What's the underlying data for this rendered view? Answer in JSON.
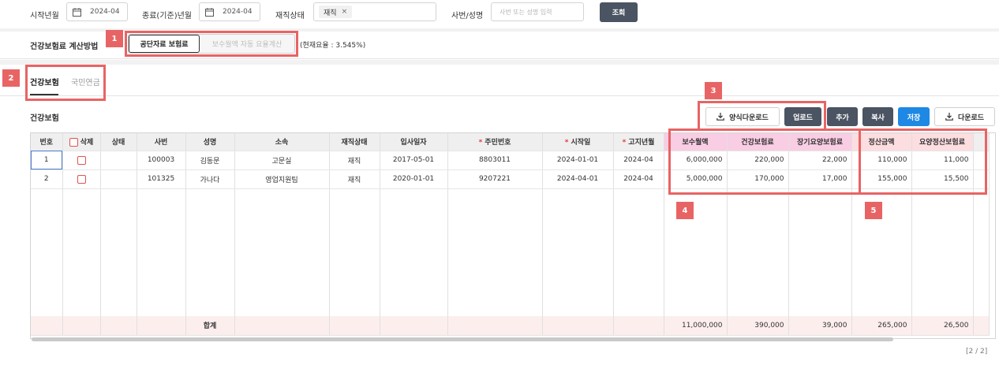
{
  "filters": {
    "start_label": "시작년월",
    "start_value": "2024-04",
    "end_label": "종료(기준)년월",
    "end_value": "2024-04",
    "status_label": "재직상태",
    "status_chip": "재직",
    "status_chip_remove": "×",
    "search_label": "사번/성명",
    "search_placeholder": "사번 또는 성명 입력",
    "search_button": "조회"
  },
  "calc": {
    "label": "건강보험료 계산방법",
    "option_active": "공단자료 보험료",
    "option_inactive": "보수월액 자동 요율계산",
    "rate_text": "(현재요율 : 3.545%)"
  },
  "tabs": {
    "active": "건강보험",
    "inactive": "국민연금"
  },
  "section": {
    "title": "건강보험",
    "btn_template_download": "양식다운로드",
    "btn_upload": "업로드",
    "btn_add": "추가",
    "btn_copy": "복사",
    "btn_save": "저장",
    "btn_download": "다운로드"
  },
  "table": {
    "headers": {
      "no": "번호",
      "delete": "삭제",
      "state": "상태",
      "emp_no": "사번",
      "name": "성명",
      "dept": "소속",
      "status": "재직상태",
      "join_date": "입사일자",
      "rrn": "주민번호",
      "start": "시작일",
      "notice": "고지년월",
      "monthly_pay": "보수월액",
      "health": "건강보험료",
      "ltc": "장기요양보험료",
      "settle": "정산금액",
      "ltc_settle": "요양정산보험료"
    },
    "rows": [
      {
        "no": "1",
        "emp_no": "100003",
        "name": "김동문",
        "dept": "고문실",
        "status": "재직",
        "join_date": "2017-05-01",
        "rrn": "8803011",
        "start": "2024-01-01",
        "notice": "2024-04",
        "monthly_pay": "6,000,000",
        "health": "220,000",
        "ltc": "22,000",
        "settle": "110,000",
        "ltc_settle": "11,000"
      },
      {
        "no": "2",
        "emp_no": "101325",
        "name": "가나다",
        "dept": "영업지원팀",
        "status": "재직",
        "join_date": "2020-01-01",
        "rrn": "9207221",
        "start": "2024-04-01",
        "notice": "2024-04",
        "monthly_pay": "5,000,000",
        "health": "170,000",
        "ltc": "17,000",
        "settle": "155,000",
        "ltc_settle": "15,500"
      }
    ],
    "total": {
      "label": "합계",
      "monthly_pay": "11,000,000",
      "health": "390,000",
      "ltc": "39,000",
      "settle": "265,000",
      "ltc_settle": "26,500"
    },
    "paging": "[2 / 2]"
  },
  "annotations": [
    "1",
    "2",
    "3",
    "4",
    "5"
  ],
  "colors": {
    "dark_button": "#4a5462",
    "save_button": "#1e88e5",
    "annotation": "#e86464",
    "pink_header": "#f9cde4",
    "rose_header": "#fcdde0"
  }
}
